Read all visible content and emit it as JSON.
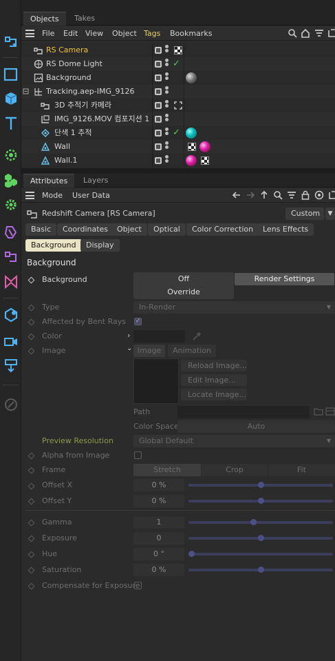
{
  "objects_panel": {
    "tabs": [
      "Objects",
      "Takes"
    ],
    "menu": [
      "File",
      "Edit",
      "View",
      "Object",
      "Tags",
      "Bookmarks"
    ],
    "rows": [
      {
        "name": "RS Camera",
        "icon": "camera-icon",
        "tags": [
          "checker-tag"
        ]
      },
      {
        "name": "RS Dome Light",
        "icon": "dome-light-icon",
        "tags": [
          "check-tag"
        ]
      },
      {
        "name": "Background",
        "icon": "background-icon",
        "tags": [
          "gray-ball-tag"
        ]
      },
      {
        "name": "Tracking.aep-IMG_9126",
        "icon": "null-icon",
        "tags": []
      },
      {
        "name": "3D 추적기 카메라",
        "icon": "camera-icon",
        "tags": [
          "target-tag"
        ]
      },
      {
        "name": "IMG_9126.MOV 컴포지션 1",
        "icon": "plane-icon",
        "tags": []
      },
      {
        "name": "단색 1 추적",
        "icon": "tracker-icon",
        "tags": [
          "check-tag",
          "teal-ball-tag"
        ]
      },
      {
        "name": "Wall",
        "icon": "wall-icon",
        "tags": [
          "checker-tag",
          "magenta-ball-tag"
        ]
      },
      {
        "name": "Wall.1",
        "icon": "wall-icon",
        "tags": [
          "magenta-ball-tag",
          "checker-tag"
        ]
      }
    ]
  },
  "attributes_panel": {
    "tabs": [
      "Attributes",
      "Layers"
    ],
    "menu": [
      "Mode",
      "User Data"
    ],
    "object_title": "Redshift Camera [RS Camera]",
    "preset": "Custom",
    "property_tabs": [
      "Basic",
      "Coordinates",
      "Object",
      "Optical",
      "Color Correction",
      "Lens Effects",
      "Background",
      "Display"
    ],
    "section": "Background",
    "background": {
      "label": "Background",
      "options": [
        "Off",
        "Render Settings",
        "Override"
      ],
      "selected": "Render Settings"
    },
    "type": {
      "label": "Type",
      "value": "In-Render"
    },
    "affected_by_bent_rays": {
      "label": "Affected by Bent Rays",
      "checked": true
    },
    "color": {
      "label": "Color"
    },
    "image": {
      "label": "Image",
      "sub_tabs": [
        "Image",
        "Animation"
      ],
      "buttons": [
        "Reload Image...",
        "Edit Image...",
        "Locate Image..."
      ]
    },
    "path": {
      "label": "Path"
    },
    "color_space": {
      "label": "Color Space",
      "value": "Auto"
    },
    "preview_resolution": {
      "label": "Preview Resolution",
      "value": "Global Default"
    },
    "alpha_from_image": {
      "label": "Alpha from Image",
      "checked": false
    },
    "frame": {
      "label": "Frame",
      "options": [
        "Stretch",
        "Crop",
        "Fit"
      ],
      "selected": "Stretch"
    },
    "sliders": [
      {
        "label": "Offset X",
        "display": "0 %",
        "level": 0.5
      },
      {
        "label": "Offset Y",
        "display": "0 %",
        "level": 0.5
      },
      {
        "label": "Gamma",
        "display": "1",
        "level": 0.45
      },
      {
        "label": "Exposure",
        "display": "0",
        "level": 0.5
      },
      {
        "label": "Hue",
        "display": "0 °",
        "level": 0.0
      },
      {
        "label": "Saturation",
        "display": "0 %",
        "level": 0.5
      }
    ],
    "compensate_for_exposure": {
      "label": "Compensate for Exposure",
      "checked": false
    }
  },
  "colors": {
    "selected_object": "#f0c040",
    "active_tab": "#e8e4c4",
    "check": "#4cd14c",
    "preview_label": "#8c9a4a"
  }
}
